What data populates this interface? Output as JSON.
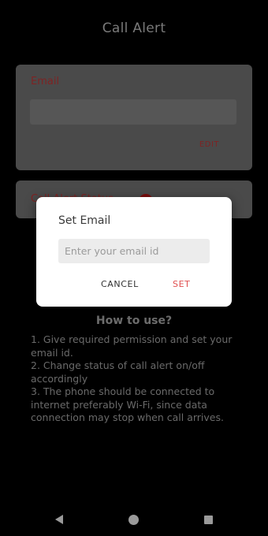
{
  "header": {
    "title": "Call Alert"
  },
  "email_card": {
    "label": "Email",
    "value": "",
    "edit_label": "EDIT"
  },
  "status_card": {
    "label": "Call Alert Status"
  },
  "howto": {
    "title": "How to use?",
    "steps": [
      "1. Give required permission and set your email id.",
      "2. Change status of call alert on/off accordingly",
      "3. The phone should be connected to internet preferably Wi-Fi, since data connection may stop when call arrives."
    ]
  },
  "dialog": {
    "title": "Set Email",
    "input_placeholder": "Enter your email id",
    "input_value": "",
    "cancel_label": "CANCEL",
    "set_label": "SET"
  },
  "navbar": {
    "icons": [
      "back-icon",
      "home-icon",
      "recents-icon"
    ]
  },
  "colors": {
    "background": "#000000",
    "card": "#4a4a4a",
    "accent_dim": "#7e2323",
    "accent": "#e05050",
    "dialog_bg": "#ffffff"
  }
}
